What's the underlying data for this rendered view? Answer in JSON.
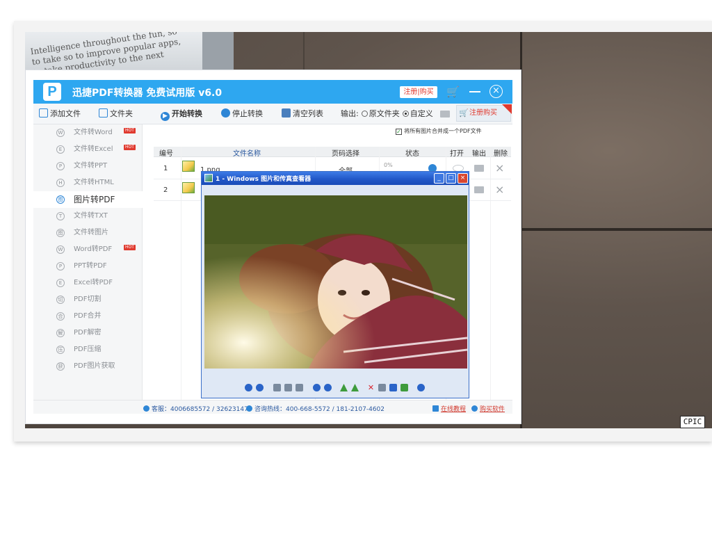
{
  "background": {
    "phone_text": "Intelligence throughout the fun, so to take so to improve popular apps, to take productivity to the next level,",
    "stamp": "CPIC"
  },
  "app": {
    "title": "迅捷PDF转换器 免费试用版 v6.0",
    "logo_letter": "P",
    "reg_buy_label": "注册|购买",
    "close_glyph": "×",
    "toolbar": {
      "add_file": "添加文件",
      "folder": "文件夹",
      "start_convert": "开始转换",
      "stop_convert": "停止转换",
      "clear_list": "清空列表",
      "output_label": "输出:",
      "original_folder": "原文件夹",
      "custom": "自定义",
      "register_buy": "注册购买"
    },
    "sidebar": {
      "items": [
        {
          "label": "文件转Word",
          "icon": "W",
          "hot": true
        },
        {
          "label": "文件转Excel",
          "icon": "E",
          "hot": true
        },
        {
          "label": "文件转PPT",
          "icon": "P",
          "hot": false
        },
        {
          "label": "文件转HTML",
          "icon": "H",
          "hot": false
        },
        {
          "label": "图片转PDF",
          "icon": "图",
          "hot": false,
          "active": true
        },
        {
          "label": "文件转TXT",
          "icon": "T",
          "hot": false
        },
        {
          "label": "文件转图片",
          "icon": "图",
          "hot": false
        },
        {
          "label": "Word转PDF",
          "icon": "W",
          "hot": true
        },
        {
          "label": "PPT转PDF",
          "icon": "P",
          "hot": false
        },
        {
          "label": "Excel转PDF",
          "icon": "E",
          "hot": false
        },
        {
          "label": "PDF切割",
          "icon": "切",
          "hot": false
        },
        {
          "label": "PDF合并",
          "icon": "合",
          "hot": false
        },
        {
          "label": "PDF解密",
          "icon": "解",
          "hot": false
        },
        {
          "label": "PDF压缩",
          "icon": "压",
          "hot": false
        },
        {
          "label": "PDF图片获取",
          "icon": "获",
          "hot": false
        }
      ],
      "hot_label": "HOT"
    },
    "content": {
      "merge_option": "将所有图片合并成一个PDF文件",
      "merge_checked": true,
      "columns": [
        "编号",
        "文件名称",
        "页码选择",
        "状态",
        "打开",
        "输出",
        "删除"
      ],
      "rows": [
        {
          "no": "1",
          "name": "1.png",
          "range": "全部",
          "progress": "0%"
        },
        {
          "no": "2",
          "name": "",
          "range": "",
          "progress": ""
        }
      ],
      "delete_glyph": "×"
    },
    "statusbar": {
      "service": "客服：4006685572 / 326231478",
      "hotline": "咨询热线：400-668-5572 / 181-2107-4602",
      "tutorial": "在线教程",
      "buy": "购买软件"
    }
  },
  "viewer": {
    "title": "1 - Windows 图片和传真查看器",
    "min": "_",
    "max": "□",
    "close": "×",
    "delete_glyph": "✕"
  },
  "colors": {
    "titlebar": "#2ea7f0",
    "accent_red": "#e03a2f",
    "link_blue": "#2c5aa0",
    "viewer_title": "#2258c8"
  }
}
